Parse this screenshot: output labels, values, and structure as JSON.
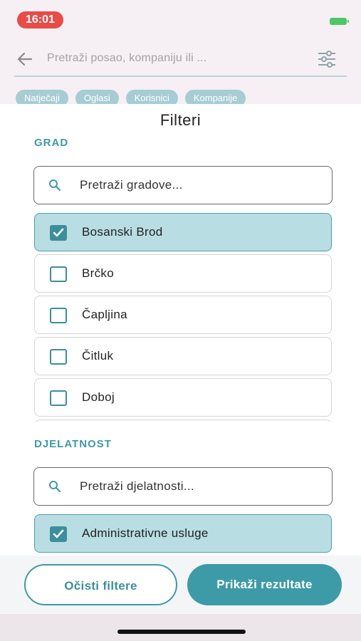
{
  "status": {
    "time": "16:01"
  },
  "search": {
    "placeholder": "Pretraži posao, kompaniju ili ..."
  },
  "chips": [
    "Natječaji",
    "Oglasi",
    "Korisnici",
    "Kompanije"
  ],
  "filters": {
    "title": "Filteri",
    "grad": {
      "label": "GRAD",
      "search_placeholder": "Pretraži gradove...",
      "options": [
        {
          "label": "Bosanski Brod",
          "checked": true
        },
        {
          "label": "Brčko",
          "checked": false
        },
        {
          "label": "Čapljina",
          "checked": false
        },
        {
          "label": "Čitluk",
          "checked": false
        },
        {
          "label": "Doboj",
          "checked": false
        }
      ]
    },
    "djelatnost": {
      "label": "DJELATNOST",
      "search_placeholder": "Pretraži djelatnosti...",
      "options": [
        {
          "label": "Administrativne usluge",
          "checked": true
        }
      ]
    }
  },
  "actions": {
    "clear_label": "Očisti filtere",
    "show_label": "Prikaži rezultate"
  },
  "colors": {
    "accent": "#3d9aa7",
    "checked_bg": "#b8dde2",
    "time_pill": "#e94b45"
  },
  "icons": {
    "back": "back-arrow-icon",
    "filter": "sliders-icon",
    "search": "search-icon",
    "checkbox": "checkbox-icon"
  }
}
